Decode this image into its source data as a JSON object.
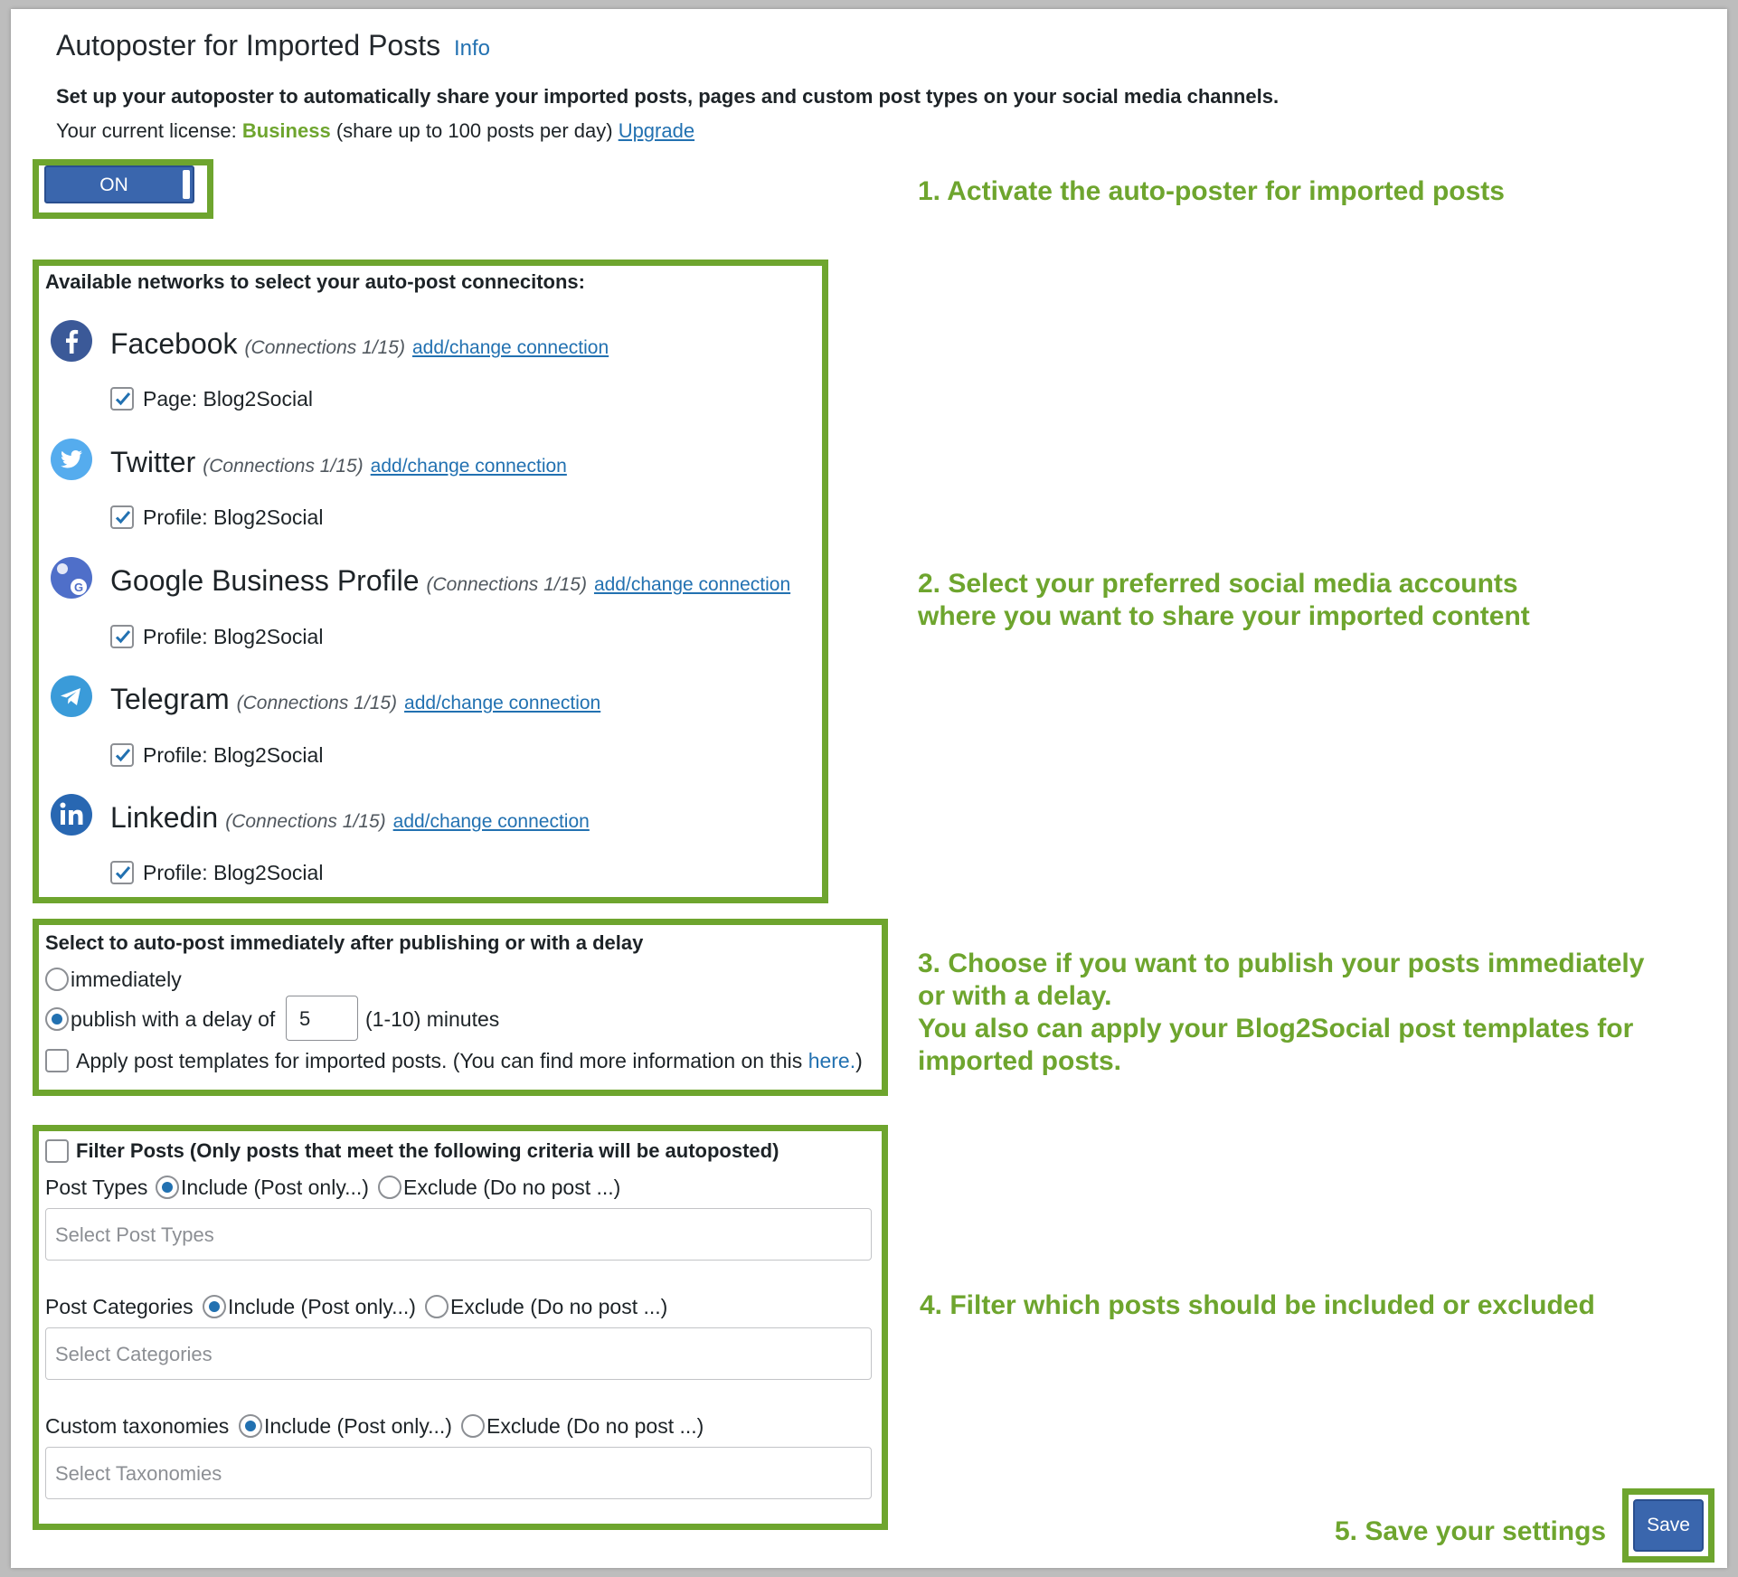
{
  "header": {
    "title": "Autoposter for Imported Posts",
    "info_link": "Info",
    "description": "Set up your autoposter to automatically share your imported posts, pages and custom post types on your social media channels.",
    "license_prefix": "Your current license:",
    "license_name": "Business",
    "license_detail": "(share up to 100 posts per day)",
    "upgrade_link": "Upgrade"
  },
  "toggle": {
    "label": "ON",
    "state": "on"
  },
  "networks": {
    "title": "Available networks to select your auto-post connecitons:",
    "items": [
      {
        "name": "Facebook",
        "connections": "(Connections 1/15)",
        "link": "add/change connection",
        "account": "Page: Blog2Social",
        "checked": true,
        "icon": "facebook-icon",
        "color": "#3b5998"
      },
      {
        "name": "Twitter",
        "connections": "(Connections 1/15)",
        "link": "add/change connection",
        "account": "Profile: Blog2Social",
        "checked": true,
        "icon": "twitter-icon",
        "color": "#55acee"
      },
      {
        "name": "Google Business Profile",
        "connections": "(Connections 1/15)",
        "link": "add/change connection",
        "account": "Profile: Blog2Social",
        "checked": true,
        "icon": "google-business-icon",
        "color": "#4f6fc9"
      },
      {
        "name": "Telegram",
        "connections": "(Connections 1/15)",
        "link": "add/change connection",
        "account": "Profile: Blog2Social",
        "checked": true,
        "icon": "telegram-icon",
        "color": "#3a9bd9"
      },
      {
        "name": "Linkedin",
        "connections": "(Connections 1/15)",
        "link": "add/change connection",
        "account": "Profile: Blog2Social",
        "checked": true,
        "icon": "linkedin-icon",
        "color": "#2867b2"
      }
    ]
  },
  "delay": {
    "title": "Select to auto-post immediately after publishing or with a delay",
    "immediately_label": "immediately",
    "delay_label": "publish with a delay of",
    "delay_value": "5",
    "delay_unit": "(1-10) minutes",
    "selected": "delay",
    "templates_label": "Apply post templates for imported posts. (You can find more information on this",
    "templates_link": "here.",
    "templates_close": ")"
  },
  "filter": {
    "title": "Filter Posts (Only posts that meet the following criteria will be autoposted)",
    "include_label": "Include (Post only...)",
    "exclude_label": "Exclude (Do no post ...)",
    "groups": [
      {
        "label": "Post Types",
        "placeholder": "Select Post Types",
        "selected": "include"
      },
      {
        "label": "Post Categories",
        "placeholder": "Select Categories",
        "selected": "include"
      },
      {
        "label": "Custom taxonomies",
        "placeholder": "Select Taxonomies",
        "selected": "include"
      }
    ]
  },
  "callouts": {
    "step1": "1. Activate the auto-poster for imported posts",
    "step2_line1": "2. Select your preferred social media accounts",
    "step2_line2": "where you want to share your imported content",
    "step3_line1": "3. Choose if you want to publish your posts immediately",
    "step3_line2": "or with a delay.",
    "step3_line3": "You also can apply your Blog2Social post templates for",
    "step3_line4": "imported posts.",
    "step4": "4. Filter which posts should be included or excluded",
    "step5": "5. Save your settings"
  },
  "save_button": "Save",
  "colors": {
    "accent_green": "#6ea52e",
    "primary_blue": "#3a66ad",
    "link_blue": "#2271b1"
  }
}
